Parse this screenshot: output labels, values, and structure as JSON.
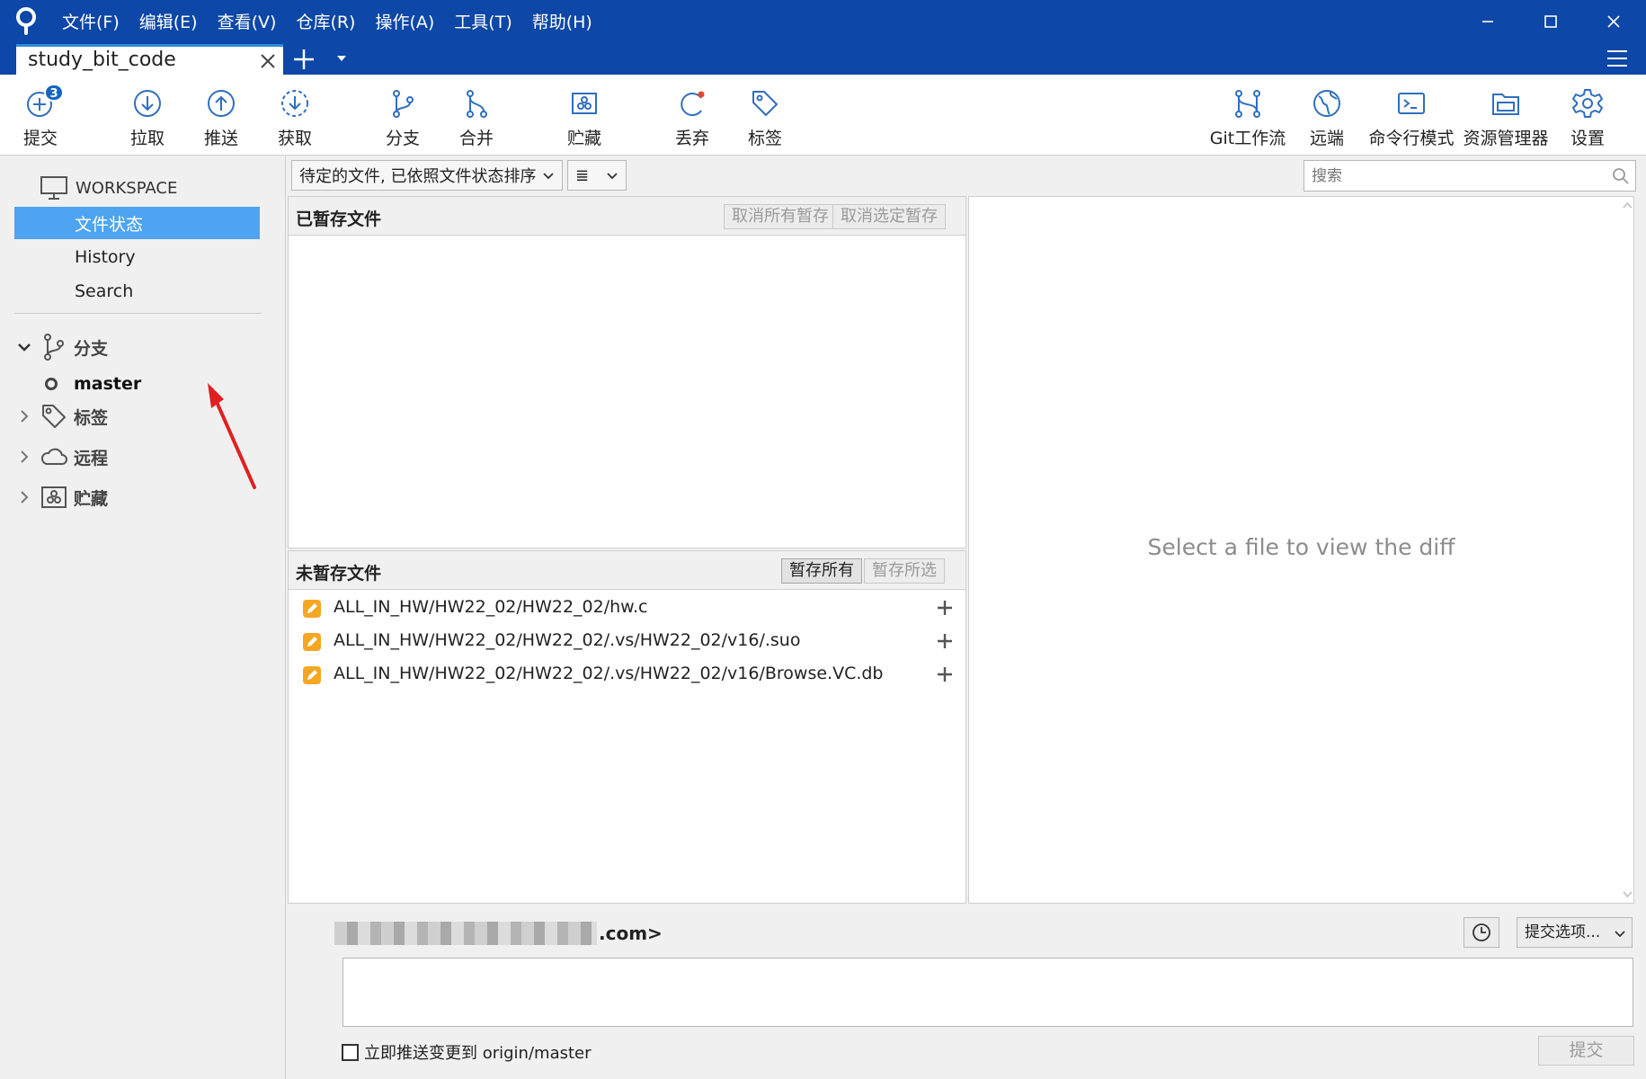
{
  "window": {
    "menu": [
      "文件(F)",
      "编辑(E)",
      "查看(V)",
      "仓库(R)",
      "操作(A)",
      "工具(T)",
      "帮助(H)"
    ]
  },
  "tabs": {
    "active_repo": "study_bit_code"
  },
  "toolbar": {
    "commit": {
      "label": "提交",
      "badge": "3"
    },
    "pull": "拉取",
    "push": "推送",
    "fetch": "获取",
    "branch": "分支",
    "merge": "合并",
    "stash": "贮藏",
    "discard": "丢弃",
    "tag": "标签",
    "git_flow": "Git工作流",
    "remote": "远端",
    "terminal": "命令行模式",
    "explorer": "资源管理器",
    "settings": "设置"
  },
  "sidebar": {
    "workspace_label": "WORKSPACE",
    "nav": [
      "文件状态",
      "History",
      "Search"
    ],
    "branches_label": "分支",
    "current_branch": "master",
    "tags_label": "标签",
    "remotes_label": "远程",
    "stashes_label": "贮藏"
  },
  "filter": {
    "sort_select": "待定的文件, 已依照文件状态排序",
    "view_select": "≣",
    "search_placeholder": "搜索"
  },
  "staged": {
    "title": "已暂存文件",
    "unstage_all": "取消所有暂存",
    "unstage_selected": "取消选定暂存"
  },
  "unstaged": {
    "title": "未暂存文件",
    "stage_all": "暂存所有",
    "stage_selected": "暂存所选",
    "files": [
      "ALL_IN_HW/HW22_02/HW22_02/hw.c",
      "ALL_IN_HW/HW22_02/HW22_02/.vs/HW22_02/v16/.suo",
      "ALL_IN_HW/HW22_02/HW22_02/.vs/HW22_02/v16/Browse.VC.db"
    ]
  },
  "diff": {
    "placeholder": "Select a file to view the diff"
  },
  "commit": {
    "author_suffix": ".com>",
    "options_label": "提交选项...",
    "message": "",
    "push_immediately_label": "立即推送变更到 origin/master",
    "push_immediately_checked": false,
    "commit_button": "提交"
  },
  "colors": {
    "titlebar": "#0d47a7",
    "selection": "#4ea4f0",
    "icon_blue": "#2f6fbf",
    "modified_file": "#f5a623",
    "annotation_arrow": "#e02020"
  }
}
